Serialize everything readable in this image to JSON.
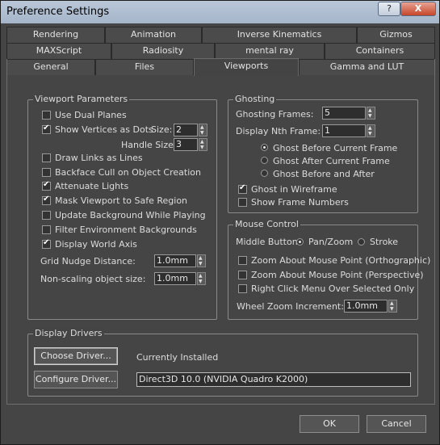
{
  "window": {
    "title": "Preference Settings",
    "help_glyph": "?",
    "close_glyph": "X"
  },
  "tabs": {
    "row1": [
      "Rendering",
      "Animation",
      "Inverse Kinematics",
      "Gizmos"
    ],
    "row2": [
      "MAXScript",
      "Radiosity",
      "mental ray",
      "Containers"
    ],
    "row3": [
      "General",
      "Files",
      "Viewports",
      "Gamma and LUT"
    ],
    "active": "Viewports"
  },
  "viewport_params": {
    "title": "Viewport Parameters",
    "use_dual_planes": {
      "label": "Use Dual Planes",
      "checked": false
    },
    "show_vertices": {
      "label": "Show Vertices as Dots",
      "checked": true
    },
    "size_label": "Size:",
    "size_value": "2",
    "handle_size_label": "Handle Size:",
    "handle_size_value": "3",
    "draw_links": {
      "label": "Draw Links as Lines",
      "checked": false
    },
    "backface_cull": {
      "label": "Backface Cull on Object Creation",
      "checked": false
    },
    "attenuate_lights": {
      "label": "Attenuate Lights",
      "checked": true
    },
    "mask_viewport": {
      "label": "Mask Viewport to Safe Region",
      "checked": true
    },
    "update_background": {
      "label": "Update Background While Playing",
      "checked": false
    },
    "filter_env": {
      "label": "Filter Environment Backgrounds",
      "checked": false
    },
    "display_world_axis": {
      "label": "Display World Axis",
      "checked": true
    },
    "grid_nudge_label": "Grid Nudge Distance:",
    "grid_nudge_value": "1.0mm",
    "nonscaling_label": "Non-scaling object size:",
    "nonscaling_value": "1.0mm"
  },
  "ghosting": {
    "title": "Ghosting",
    "frames_label": "Ghosting Frames:",
    "frames_value": "5",
    "nth_label": "Display Nth Frame:",
    "nth_value": "1",
    "before": "Ghost Before Current Frame",
    "after": "Ghost After Current Frame",
    "before_after": "Ghost Before and After",
    "selected": "before",
    "wireframe": {
      "label": "Ghost in Wireframe",
      "checked": true
    },
    "frame_numbers": {
      "label": "Show Frame Numbers",
      "checked": false
    }
  },
  "mouse": {
    "title": "Mouse Control",
    "middle_label": "Middle Button:",
    "pan_zoom": "Pan/Zoom",
    "stroke": "Stroke",
    "selected": "pan_zoom",
    "zoom_ortho": {
      "label": "Zoom About Mouse Point (Orthographic)",
      "checked": false
    },
    "zoom_persp": {
      "label": "Zoom About Mouse Point (Perspective)",
      "checked": false
    },
    "right_click": {
      "label": "Right Click Menu Over Selected Only",
      "checked": false
    },
    "wheel_label": "Wheel Zoom Increment:",
    "wheel_value": "1.0mm"
  },
  "drivers": {
    "title": "Display Drivers",
    "choose": "Choose Driver...",
    "configure": "Configure Driver...",
    "installed_label": "Currently Installed",
    "installed_value": "Direct3D 10.0 (NVIDIA Quadro K2000)"
  },
  "footer": {
    "ok": "OK",
    "cancel": "Cancel"
  }
}
